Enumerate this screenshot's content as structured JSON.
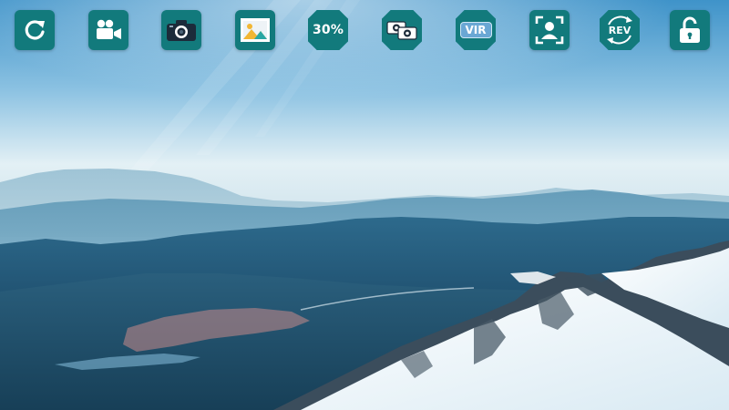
{
  "toolbar": {
    "buttons": [
      {
        "id": "refresh",
        "icon": "refresh-icon"
      },
      {
        "id": "video",
        "icon": "video-camera-icon"
      },
      {
        "id": "photo",
        "icon": "camera-icon"
      },
      {
        "id": "gallery",
        "icon": "image-gallery-icon"
      },
      {
        "id": "zoom",
        "icon": "zoom-level",
        "label": "30%"
      },
      {
        "id": "switch-camera",
        "icon": "switch-camera-icon"
      },
      {
        "id": "vir",
        "icon": "vir-badge",
        "label": "VIR"
      },
      {
        "id": "face-detect",
        "icon": "face-frame-icon"
      },
      {
        "id": "reverse",
        "icon": "reverse-icon",
        "label": "REV"
      },
      {
        "id": "lock",
        "icon": "unlock-icon"
      }
    ]
  },
  "colors": {
    "button_bg": "#127a7c",
    "icon_fg": "#ffffff"
  }
}
